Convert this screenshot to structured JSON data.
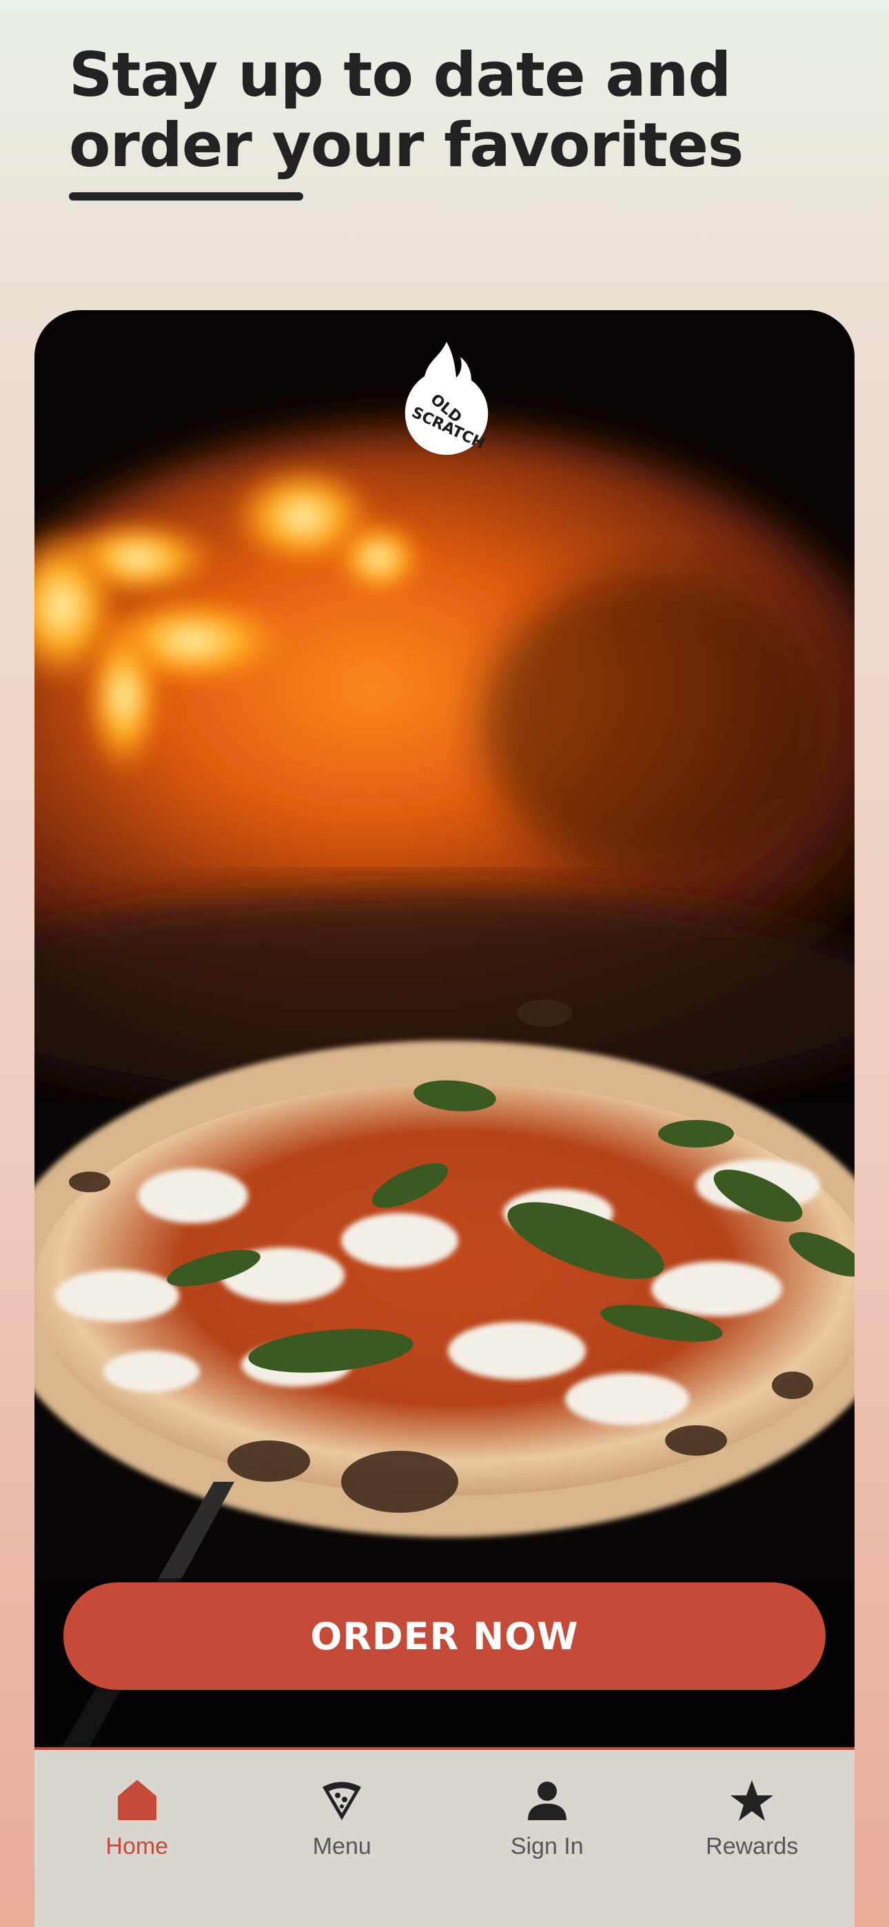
{
  "header": {
    "title_line1": "Stay up to date and",
    "title_line2": "order your favorites"
  },
  "hero": {
    "logo_icon": "old-scratch-flame-logo",
    "logo_text": "OLD SCRATCH",
    "image_description_icon": "pizza-oven-photo"
  },
  "cta": {
    "order_label": "ORDER NOW"
  },
  "tabbar": {
    "tabs": [
      {
        "label": "Home",
        "icon": "home-icon",
        "active": true
      },
      {
        "label": "Menu",
        "icon": "pizza-slice-icon",
        "active": false
      },
      {
        "label": "Sign In",
        "icon": "person-icon",
        "active": false
      },
      {
        "label": "Rewards",
        "icon": "star-icon",
        "active": false
      }
    ]
  },
  "colors": {
    "accent": "#c64a38",
    "text": "#222222",
    "tab_inactive": "#555555",
    "tabbar_bg": "#d9d5cf"
  }
}
